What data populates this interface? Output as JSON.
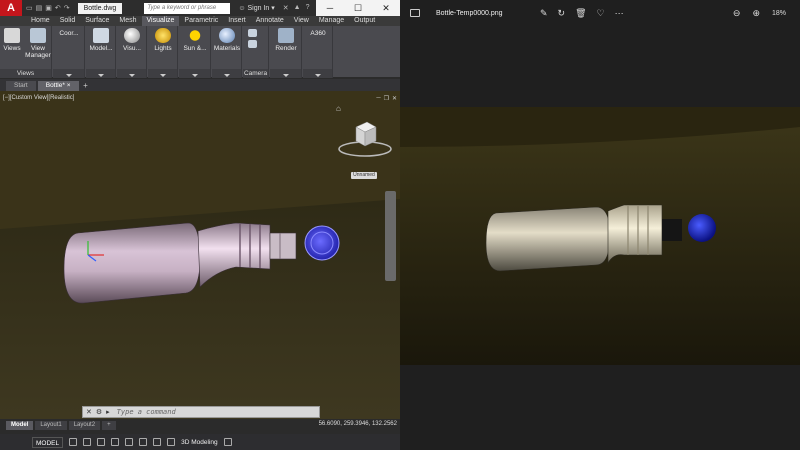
{
  "cad": {
    "app_logo": "A",
    "doc_tab": "Bottle.dwg",
    "search_placeholder": "Type a keyword or phrase",
    "sign_in": "Sign In",
    "ribbon_tabs": [
      "Home",
      "Solid",
      "Surface",
      "Mesh",
      "Visualize",
      "Parametric",
      "Insert",
      "Annotate",
      "View",
      "Manage",
      "Output"
    ],
    "active_ribbon_tab": "Visualize",
    "ribbon_buttons": {
      "views": "Views",
      "view_manager": "View Manager",
      "coords": "Coor...",
      "model": "Model...",
      "visual": "Visu...",
      "lights": "Lights",
      "sun": "Sun &...",
      "materials": "Materials",
      "render": "Render",
      "a360": "A360"
    },
    "ribbon_group_labels": {
      "views": "Views",
      "camera": "Camera"
    },
    "file_tabs": [
      "Start",
      "Bottle*"
    ],
    "active_file_tab": "Bottle*",
    "viewport_label": "[−][Custom View][Realistic]",
    "wcs_label": "Unnamed",
    "cmd_placeholder": "Type a command",
    "layout_tabs": [
      "Model",
      "Layout1",
      "Layout2"
    ],
    "active_layout_tab": "Model",
    "coordinates": "56.6090, 259.3946, 132.2562",
    "status_model": "MODEL",
    "workspace": "3D Modeling",
    "colors": {
      "viewport_bg": "#3a3319",
      "app_red": "#c4161c",
      "ribbon": "#4a4a4f"
    }
  },
  "viewer": {
    "file_name": "Bottle-Temp0000.png",
    "zoom_level": "18%",
    "colors": {
      "bg": "#1f1f1f",
      "photo_bg": "#2f2a12"
    }
  }
}
